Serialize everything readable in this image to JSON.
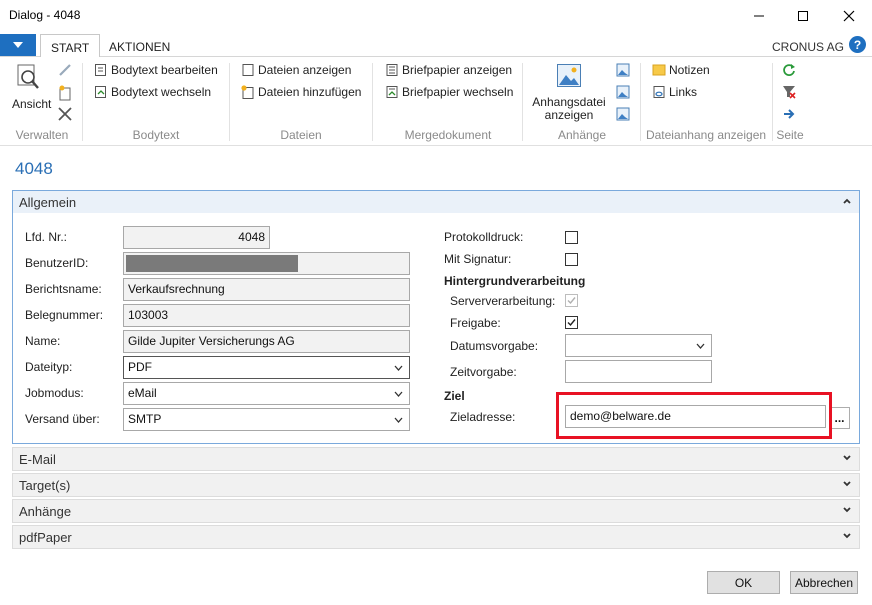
{
  "window": {
    "title": "Dialog - 4048"
  },
  "ribbon": {
    "tabs": [
      {
        "label": "START"
      },
      {
        "label": "AKTIONEN"
      }
    ],
    "company": "CRONUS AG",
    "help": "?",
    "groups": {
      "verwalten": {
        "label": "Verwalten",
        "ansicht": "Ansicht"
      },
      "bodytext": {
        "label": "Bodytext",
        "bearbeiten": "Bodytext bearbeiten",
        "wechseln": "Bodytext wechseln"
      },
      "dateien": {
        "label": "Dateien",
        "anzeigen": "Dateien anzeigen",
        "hinzufuegen": "Dateien hinzufügen"
      },
      "mergedokument": {
        "label": "Mergedokument",
        "anzeigen": "Briefpapier anzeigen",
        "wechseln": "Briefpapier wechseln"
      },
      "anhaenge": {
        "label": "Anhänge",
        "anzeigen_line1": "Anhangsdatei",
        "anzeigen_line2": "anzeigen"
      },
      "dateianhang": {
        "label": "Dateianhang anzeigen",
        "notizen": "Notizen",
        "links": "Links"
      },
      "seite": {
        "label": "Seite"
      }
    }
  },
  "page": {
    "title": "4048"
  },
  "general": {
    "header": "Allgemein",
    "left_fields": [
      {
        "label": "Lfd. Nr.:",
        "value": "4048"
      },
      {
        "label": "BenutzerID:",
        "value": ""
      },
      {
        "label": "Berichtsname:",
        "value": "Verkaufsrechnung"
      },
      {
        "label": "Belegnummer:",
        "value": "103003"
      },
      {
        "label": "Name:",
        "value": "Gilde Jupiter Versicherungs AG"
      },
      {
        "label": "Dateityp:",
        "value": "PDF"
      },
      {
        "label": "Jobmodus:",
        "value": "eMail"
      },
      {
        "label": "Versand über:",
        "value": "SMTP"
      }
    ],
    "protokolldruck": {
      "label": "Protokolldruck:",
      "checked": false
    },
    "mit_signatur": {
      "label": "Mit Signatur:",
      "checked": false
    },
    "hintergrund": {
      "label": "Hintergrundverarbeitung",
      "serververarbeitung": {
        "label": "Serververarbeitung:",
        "checked": true
      },
      "freigabe": {
        "label": "Freigabe:",
        "checked": true
      },
      "datumsvorgabe": {
        "label": "Datumsvorgabe:",
        "value": ""
      },
      "zeitvorgabe": {
        "label": "Zeitvorgabe:",
        "value": ""
      }
    },
    "ziel": {
      "label": "Ziel",
      "zieladresse": {
        "label": "Zieladresse:",
        "value": "demo@belware.de"
      },
      "assist": "..."
    }
  },
  "fasttabs": [
    {
      "label": "E-Mail"
    },
    {
      "label": "Target(s)"
    },
    {
      "label": "Anhänge"
    },
    {
      "label": "pdfPaper"
    }
  ],
  "footer": {
    "ok": "OK",
    "cancel": "Abbrechen"
  },
  "colors": {
    "accent": "#1e6fc0",
    "highlight": "#e81123",
    "title": "#2a6fb5"
  }
}
